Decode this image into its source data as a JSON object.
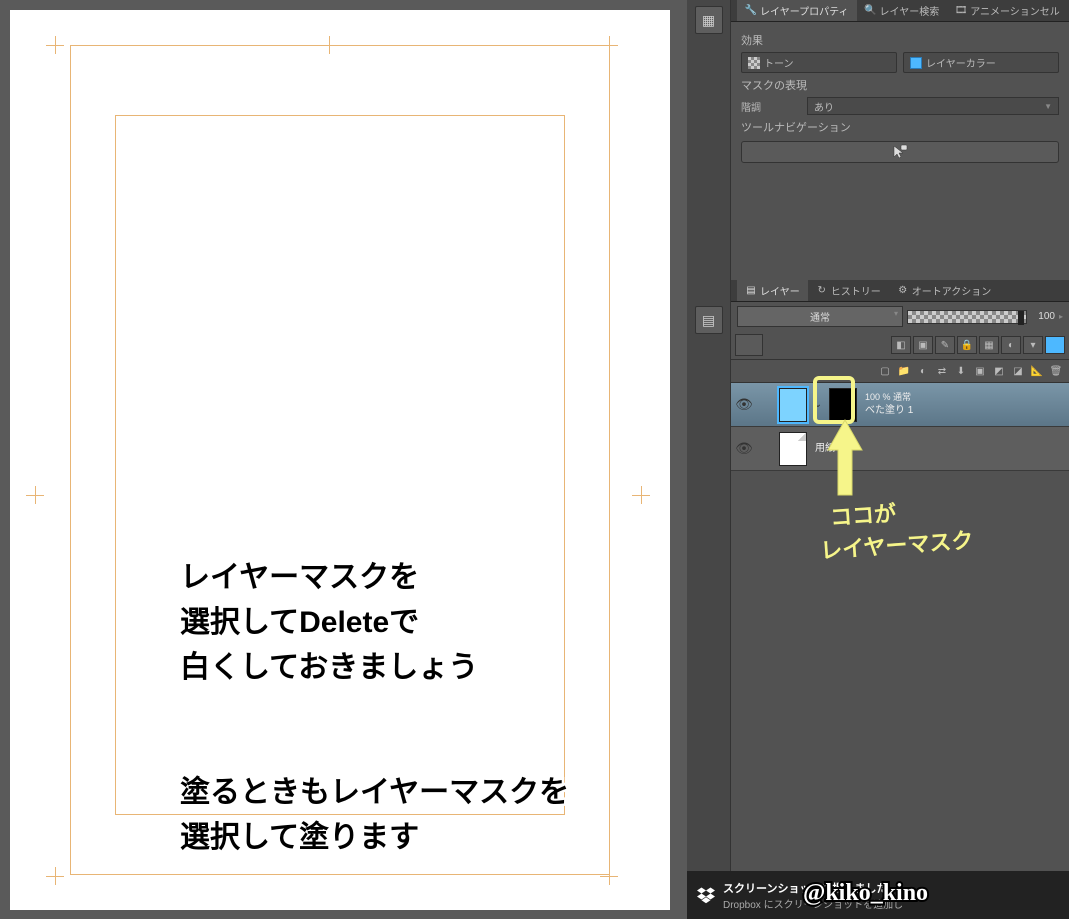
{
  "tabs_upper": {
    "layer_property": "レイヤープロパティ",
    "layer_search": "レイヤー検索",
    "animation_cel": "アニメーションセル"
  },
  "property": {
    "effect_label": "効果",
    "tone_label": "トーン",
    "layer_color_label": "レイヤーカラー",
    "mask_expr_label": "マスクの表現",
    "gradation_label": "階調",
    "gradation_value": "あり",
    "tool_nav_label": "ツールナビゲーション"
  },
  "tabs_lower": {
    "layer": "レイヤー",
    "history": "ヒストリー",
    "auto_action": "オートアクション"
  },
  "layer_controls": {
    "blend_mode": "通常",
    "opacity": "100"
  },
  "layers": [
    {
      "opacity_mode": "100 % 通常",
      "name": "べた塗り 1"
    },
    {
      "opacity_mode": "",
      "name": "用紙"
    }
  ],
  "annotations": {
    "mask_arrow_text1": "ココが",
    "mask_arrow_text2": "レイヤーマスク",
    "instruction1_l1": "レイヤーマスクを",
    "instruction1_l2": "選択してDeleteで",
    "instruction1_l3": "白くしておきましょう",
    "instruction2_l1": "塗るときもレイヤーマスクを",
    "instruction2_l2": "選択して塗ります"
  },
  "notification": {
    "title": "スクリーンショットを撮りました",
    "body": "Dropbox にスクリーンショットを追加し"
  },
  "signature": "@kiko_kino"
}
